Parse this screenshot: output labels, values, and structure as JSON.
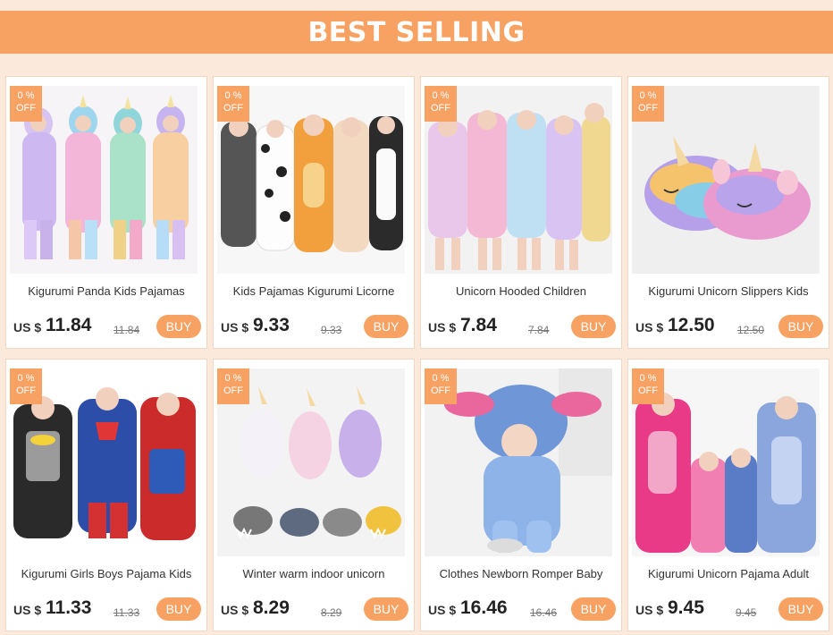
{
  "banner": {
    "title": "BEST SELLING"
  },
  "badge": {
    "line1": "0 %",
    "line2": "OFF"
  },
  "currency": "US $",
  "buy_label": "BUY",
  "colors": {
    "accent": "#f7a163",
    "background": "#fbe9dc"
  },
  "products": [
    {
      "title": "Kigurumi Panda Kids Pajamas",
      "price": "11.84",
      "old_price": "11.84",
      "image": "rainbow-unicorn-onesies"
    },
    {
      "title": "Kids Pajamas Kigurumi Licorne",
      "price": "9.33",
      "old_price": "9.33",
      "image": "animal-onesies"
    },
    {
      "title": "Unicorn Hooded Children",
      "price": "7.84",
      "old_price": "7.84",
      "image": "unicorn-bathrobes"
    },
    {
      "title": "Kigurumi Unicorn Slippers  Kids",
      "price": "12.50",
      "old_price": "12.50",
      "image": "unicorn-slippers"
    },
    {
      "title": "Kigurumi Girls Boys Pajama Kids",
      "price": "11.33",
      "old_price": "11.33",
      "image": "superhero-onesies"
    },
    {
      "title": "Winter warm indoor unicorn",
      "price": "8.29",
      "old_price": "8.29",
      "image": "unicorn-and-paw-slippers"
    },
    {
      "title": "Clothes Newborn Romper Baby",
      "price": "16.46",
      "old_price": "16.46",
      "image": "stitch-baby-romper"
    },
    {
      "title": "Kigurumi Unicorn Pajama Adult",
      "price": "9.45",
      "old_price": "9.45",
      "image": "stitch-family-pajamas"
    }
  ]
}
